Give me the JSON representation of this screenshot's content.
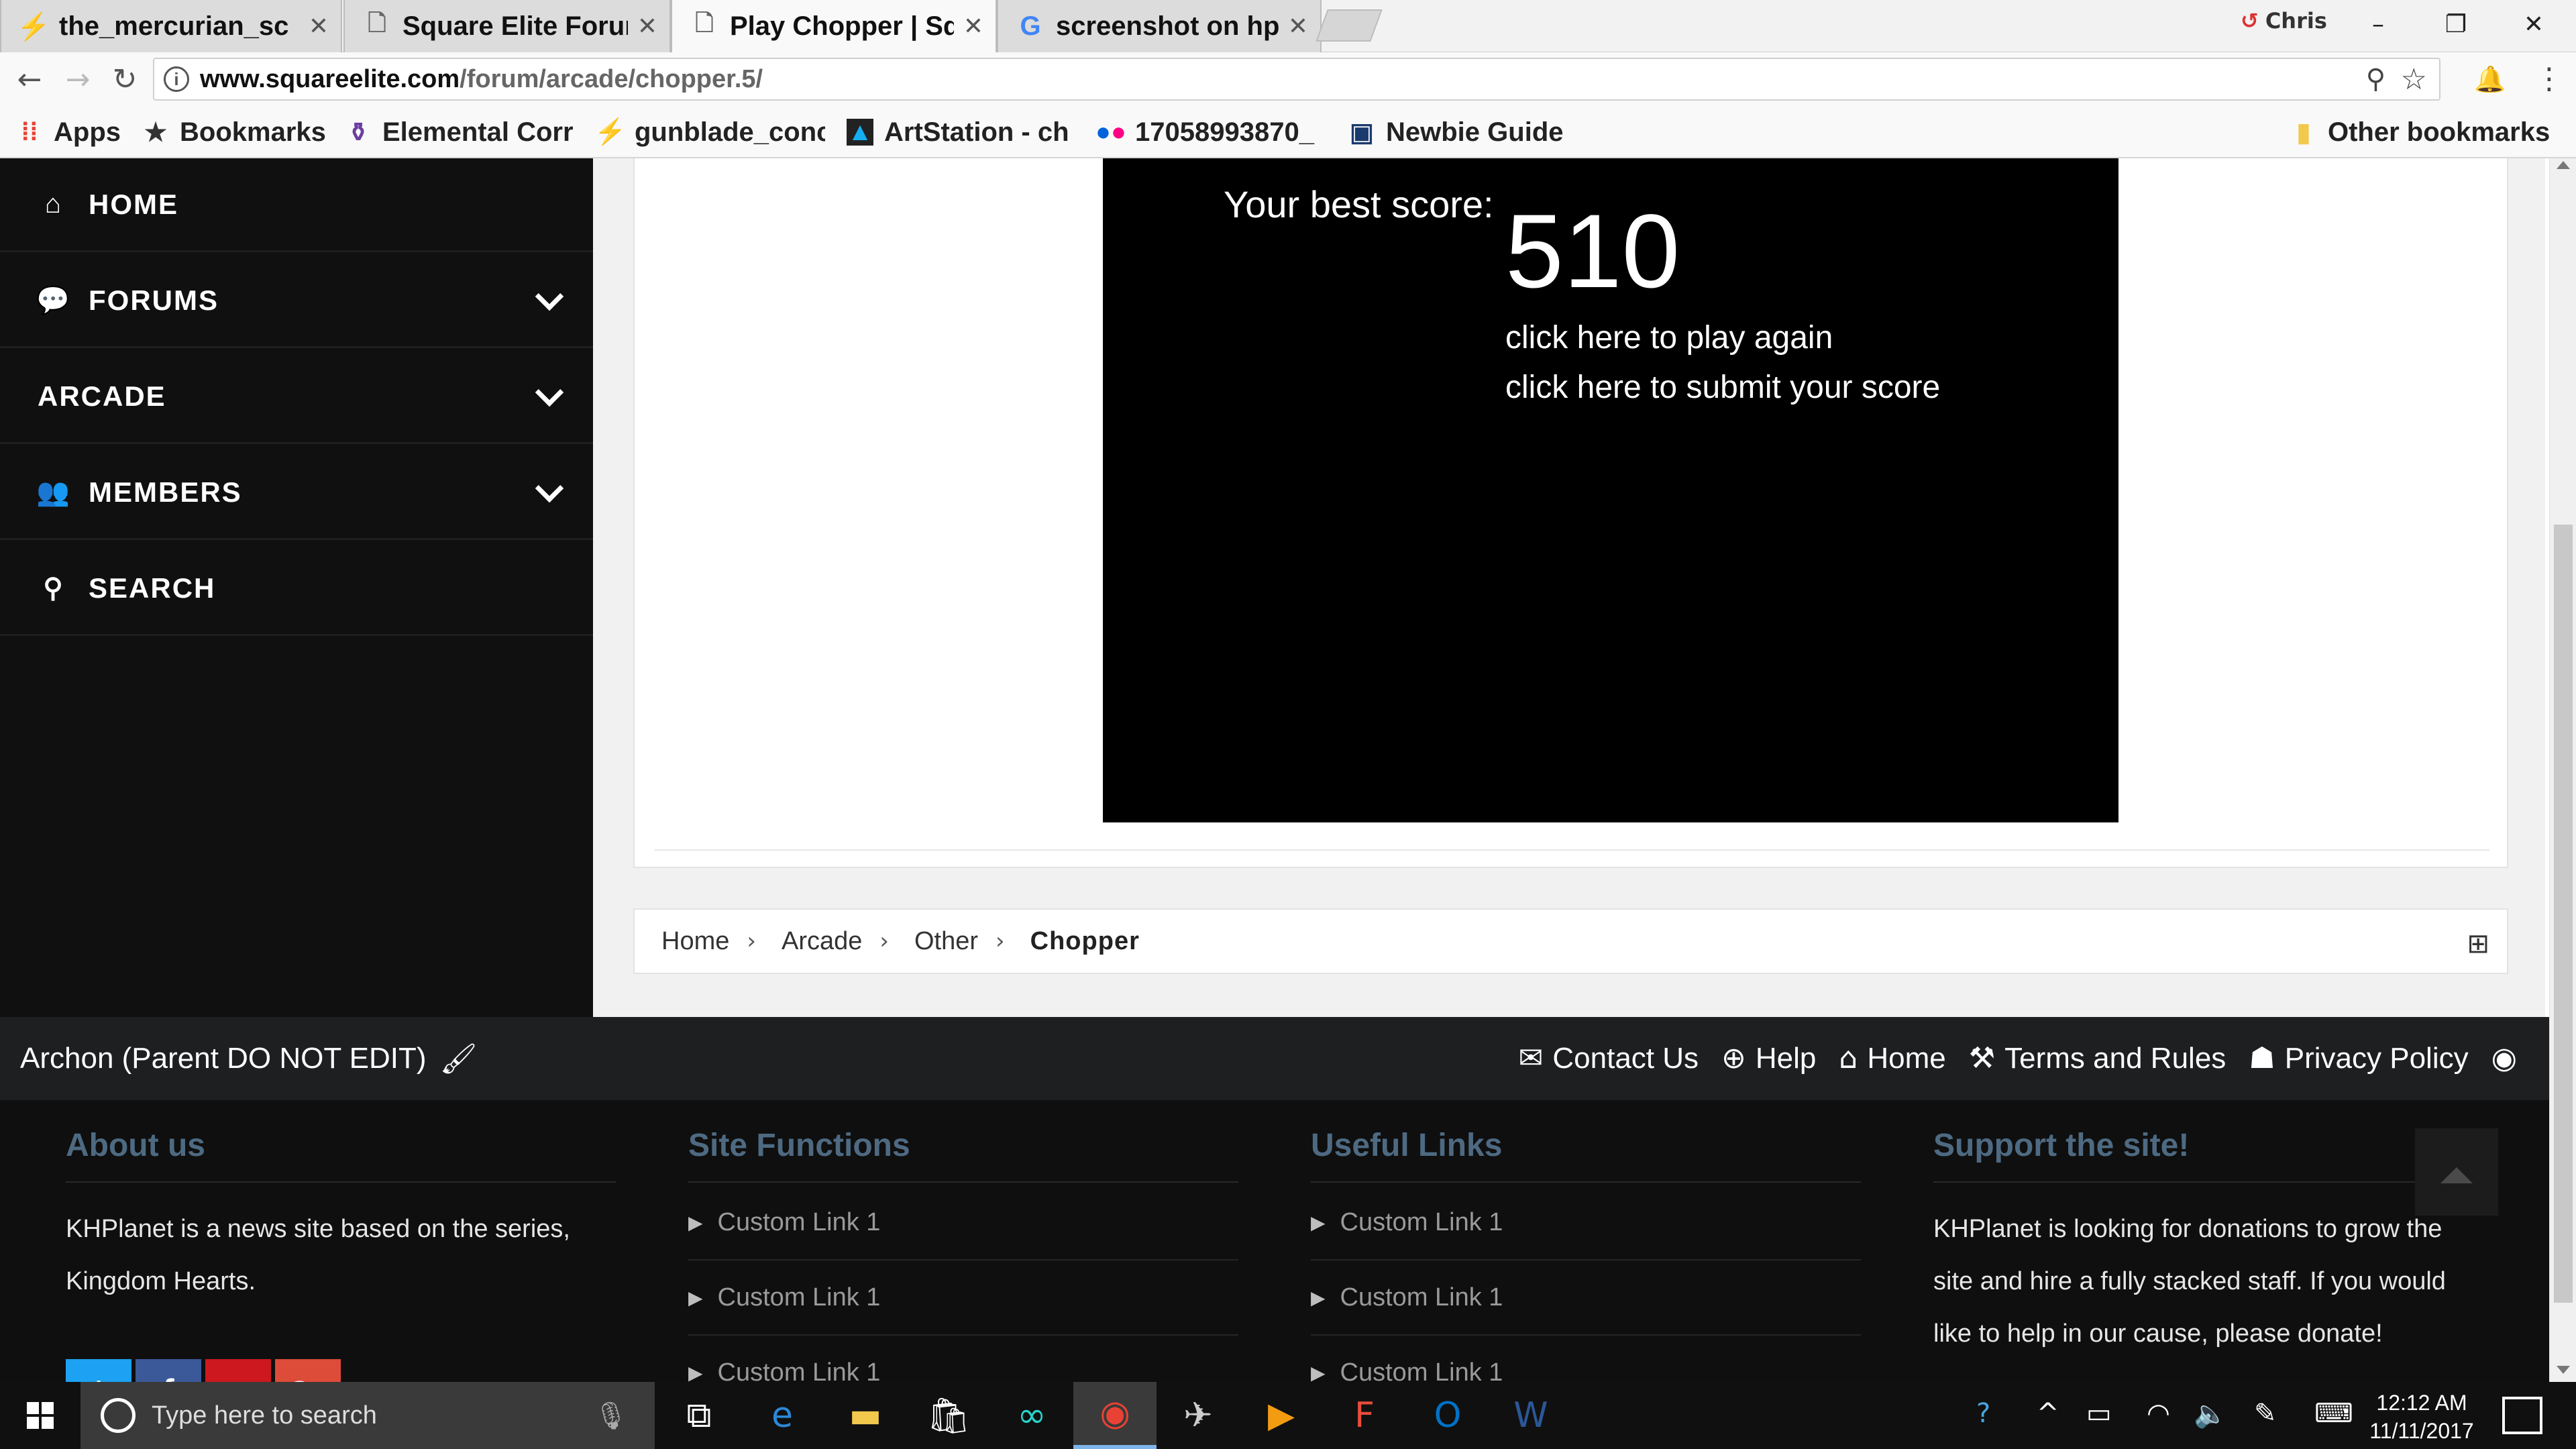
{
  "browser": {
    "tabs": [
      {
        "title": "the_mercurian_sc",
        "icon": "green-bolt-icon",
        "active": false
      },
      {
        "title": "Square Elite Forur",
        "icon": "page-icon",
        "active": false
      },
      {
        "title": "Play Chopper | Sq",
        "icon": "page-icon",
        "active": true
      },
      {
        "title": "screenshot on hp",
        "icon": "google-icon",
        "active": false
      }
    ],
    "profile_name": "Chris",
    "address": {
      "domain": "www.squareelite.com",
      "path": "/forum/arcade/chopper.5/"
    },
    "bookmarks": [
      {
        "label": "Apps",
        "icon": "apps-grid-icon"
      },
      {
        "label": "Bookmarks",
        "icon": "star-icon"
      },
      {
        "label": "Elemental Corr",
        "icon": "potion-icon"
      },
      {
        "label": "gunblade_conc",
        "icon": "green-bolt-icon"
      },
      {
        "label": "ArtStation - ch",
        "icon": "artstation-icon"
      },
      {
        "label": "17058993870_",
        "icon": "flickr-icon"
      },
      {
        "label": "Newbie Guide",
        "icon": "book-icon"
      }
    ],
    "other_bookmarks": "Other bookmarks"
  },
  "sidebar": {
    "items": [
      {
        "label": "HOME",
        "icon": "home-icon",
        "has_chevron": false
      },
      {
        "label": "FORUMS",
        "icon": "comments-icon",
        "has_chevron": true
      },
      {
        "label": "ARCADE",
        "icon": "",
        "has_chevron": true
      },
      {
        "label": "MEMBERS",
        "icon": "users-icon",
        "has_chevron": true
      },
      {
        "label": "SEARCH",
        "icon": "search-icon",
        "has_chevron": false
      }
    ]
  },
  "game": {
    "best_label": "Your best score:",
    "best_score": "510",
    "play_again": "click here to play again",
    "submit_score": "click here to submit your score"
  },
  "breadcrumbs": [
    "Home",
    "Arcade",
    "Other",
    "Chopper"
  ],
  "footer": {
    "style_name": "Archon (Parent DO NOT EDIT)",
    "links": [
      {
        "label": "Contact Us",
        "icon": "envelope-icon"
      },
      {
        "label": "Help",
        "icon": "lifebuoy-icon"
      },
      {
        "label": "Home",
        "icon": "home-icon"
      },
      {
        "label": "Terms and Rules",
        "icon": "gavel-icon"
      },
      {
        "label": "Privacy Policy",
        "icon": "user-secret-icon"
      }
    ],
    "columns": {
      "about": {
        "title": "About us",
        "text": "KHPlanet is a news site based on the series, Kingdom Hearts."
      },
      "site_functions": {
        "title": "Site Functions",
        "links": [
          "Custom Link 1",
          "Custom Link 1",
          "Custom Link 1"
        ]
      },
      "useful_links": {
        "title": "Useful Links",
        "links": [
          "Custom Link 1",
          "Custom Link 1",
          "Custom Link 1"
        ]
      },
      "support": {
        "title": "Support the site!",
        "text": "KHPlanet is looking for donations to grow the site and hire a fully stacked staff. If you would like to help in our cause, please donate!"
      }
    },
    "social": [
      {
        "glyph": "t",
        "name": "twitter",
        "color": "#1da1f2"
      },
      {
        "glyph": "f",
        "name": "facebook",
        "color": "#3b5998"
      },
      {
        "glyph": "▶",
        "name": "youtube",
        "color": "#cc181e"
      },
      {
        "glyph": "G+",
        "name": "google-plus",
        "color": "#dd4b39"
      }
    ]
  },
  "taskbar": {
    "search_placeholder": "Type here to search",
    "time": "12:12 AM",
    "date": "11/11/2017"
  },
  "colors": {
    "sidebar_bg": "#101010",
    "footer_heading": "#4e6a82",
    "taskbar_accent": "#7eb4ea"
  }
}
